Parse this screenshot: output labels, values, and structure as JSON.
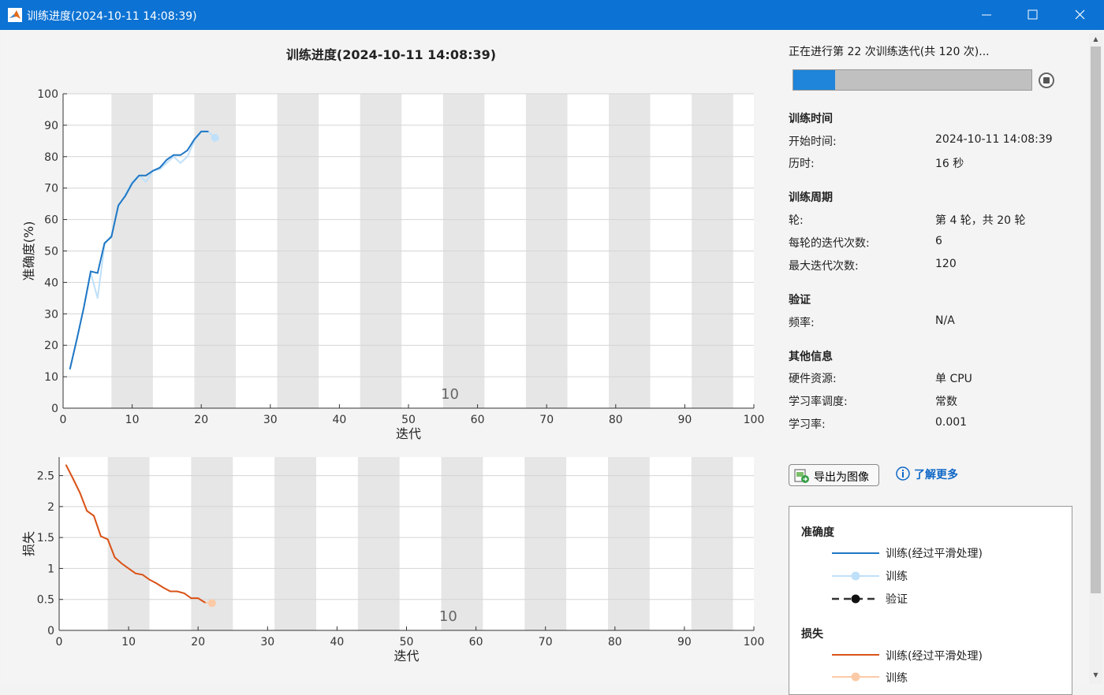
{
  "window": {
    "title": "训练进度(2024-10-11 14:08:39)",
    "buttons": [
      "minimize-icon",
      "maximize-icon",
      "close-icon"
    ]
  },
  "main_title": "训练进度(2024-10-11 14:08:39)",
  "status_text": "正在进行第 22 次训练迭代(共 120 次)...",
  "progress": {
    "fraction": 0.175
  },
  "colors": {
    "accent": "#0c72d3",
    "train_smooth": "#1f77c4",
    "train_raw": "#bfe0fa",
    "loss_smooth": "#d95319",
    "loss_raw": "#fccaa6",
    "epoch_band": "#e6e6e6"
  },
  "info": {
    "training_time": {
      "heading": "训练时间",
      "rows": [
        {
          "label": "开始时间:",
          "value": "2024-10-11 14:08:39"
        },
        {
          "label": "历时:",
          "value": "16 秒"
        }
      ]
    },
    "cycle": {
      "heading": "训练周期",
      "rows": [
        {
          "label": "轮:",
          "value": "第 4 轮，共 20 轮"
        },
        {
          "label": "每轮的迭代次数:",
          "value": "6"
        },
        {
          "label": "最大迭代次数:",
          "value": "120"
        }
      ]
    },
    "validation": {
      "heading": "验证",
      "rows": [
        {
          "label": "频率:",
          "value": "N/A"
        }
      ]
    },
    "other": {
      "heading": "其他信息",
      "rows": [
        {
          "label": "硬件资源:",
          "value": "单 CPU"
        },
        {
          "label": "学习率调度:",
          "value": "常数"
        },
        {
          "label": "学习率:",
          "value": "0.001"
        }
      ]
    }
  },
  "buttons": {
    "export": "导出为图像",
    "learn_more": "了解更多"
  },
  "legend": {
    "accuracy_heading": "准确度",
    "accuracy_items": [
      "训练(经过平滑处理)",
      "训练",
      "验证"
    ],
    "loss_heading": "损失",
    "loss_items": [
      "训练(经过平滑处理)",
      "训练"
    ]
  },
  "chart_data": [
    {
      "type": "line",
      "xlabel": "迭代",
      "ylabel": "准确度(%)",
      "xlim": [
        0,
        100
      ],
      "ylim": [
        0,
        100
      ],
      "xticks": [
        0,
        10,
        20,
        30,
        40,
        50,
        60,
        70,
        80,
        90,
        100
      ],
      "yticks": [
        0,
        10,
        20,
        30,
        40,
        50,
        60,
        70,
        80,
        90,
        100
      ],
      "epoch_bands": [
        [
          7,
          13
        ],
        [
          19,
          25
        ],
        [
          31,
          37
        ],
        [
          43,
          49
        ],
        [
          55,
          61
        ],
        [
          67,
          73
        ],
        [
          79,
          85
        ],
        [
          91,
          97
        ]
      ],
      "annotation": {
        "text": "10",
        "x": 56
      },
      "grid": true,
      "series": [
        {
          "name": "训练(经过平滑处理)",
          "x": [
            1,
            2,
            3,
            4,
            5,
            6,
            7,
            8,
            9,
            10,
            11,
            12,
            13,
            14,
            15,
            16,
            17,
            18,
            19,
            20,
            21
          ],
          "y": [
            12.5,
            22,
            32,
            43.5,
            43,
            52.5,
            54.5,
            64.5,
            67.5,
            71.5,
            74,
            74,
            75.5,
            76.5,
            79,
            80.5,
            80.5,
            82,
            85.5,
            88,
            88
          ]
        },
        {
          "name": "训练",
          "x": [
            1,
            2,
            3,
            4,
            5,
            6,
            7,
            8,
            9,
            10,
            11,
            12,
            13,
            14,
            15,
            16,
            17,
            18,
            19,
            20,
            21,
            22
          ],
          "y": [
            12.5,
            22,
            32,
            43,
            35,
            52,
            55,
            64,
            68,
            72,
            74,
            72,
            75.5,
            76,
            78,
            80,
            78,
            80,
            85,
            88,
            88,
            86
          ]
        }
      ]
    },
    {
      "type": "line",
      "xlabel": "迭代",
      "ylabel": "损失",
      "xlim": [
        0,
        100
      ],
      "ylim": [
        0,
        2.8
      ],
      "xticks": [
        0,
        10,
        20,
        30,
        40,
        50,
        60,
        70,
        80,
        90,
        100
      ],
      "yticks": [
        0,
        0.5,
        1,
        1.5,
        2,
        2.5
      ],
      "epoch_bands": [
        [
          7,
          13
        ],
        [
          19,
          25
        ],
        [
          31,
          37
        ],
        [
          43,
          49
        ],
        [
          55,
          61
        ],
        [
          67,
          73
        ],
        [
          79,
          85
        ],
        [
          91,
          97
        ]
      ],
      "annotation": {
        "text": "10",
        "x": 56
      },
      "grid": true,
      "series": [
        {
          "name": "训练(经过平滑处理)",
          "x": [
            1,
            2,
            3,
            4,
            5,
            6,
            7,
            8,
            9,
            10,
            11,
            12,
            13,
            14,
            15,
            16,
            17,
            18,
            19,
            20,
            21
          ],
          "y": [
            2.67,
            2.45,
            2.22,
            1.93,
            1.85,
            1.52,
            1.47,
            1.18,
            1.08,
            1.0,
            0.92,
            0.9,
            0.82,
            0.76,
            0.69,
            0.63,
            0.63,
            0.6,
            0.52,
            0.52,
            0.45
          ]
        },
        {
          "name": "训练",
          "x": [
            1,
            2,
            3,
            4,
            5,
            6,
            7,
            8,
            9,
            10,
            11,
            12,
            13,
            14,
            15,
            16,
            17,
            18,
            19,
            20,
            21,
            22
          ],
          "y": [
            2.67,
            2.45,
            2.22,
            1.93,
            1.85,
            1.52,
            1.47,
            1.18,
            1.08,
            1.0,
            0.92,
            0.9,
            0.82,
            0.76,
            0.69,
            0.63,
            0.63,
            0.6,
            0.52,
            0.52,
            0.45,
            0.44
          ]
        }
      ]
    }
  ]
}
